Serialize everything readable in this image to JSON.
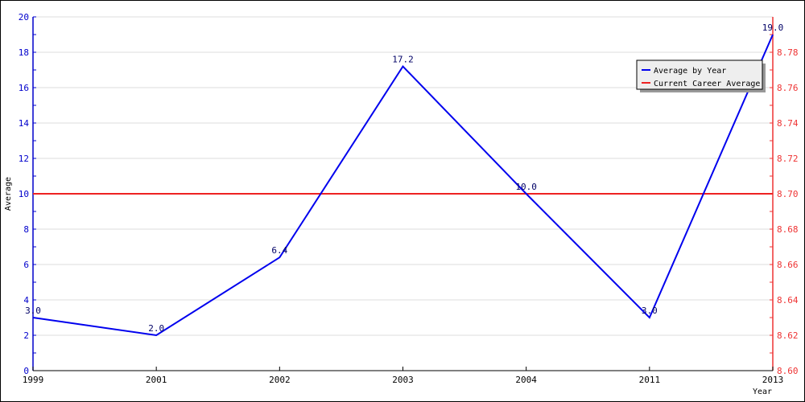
{
  "chart_data": {
    "type": "line",
    "title": "",
    "xlabel": "Year",
    "ylabel": "Average",
    "categories": [
      "1999",
      "2001",
      "2002",
      "2003",
      "2004",
      "2011",
      "2013"
    ],
    "series": [
      {
        "name": "Average by Year",
        "color": "#0000ee",
        "axis": "left",
        "values": [
          3.0,
          2.0,
          6.4,
          17.2,
          10.0,
          3.0,
          19.0
        ],
        "labels": [
          "3.0",
          "2.0",
          "6.4",
          "17.2",
          "10.0",
          "3.0",
          "19.0"
        ]
      },
      {
        "name": "Current Career Average",
        "color": "#ee2222",
        "axis": "right",
        "values": [
          8.7,
          8.7,
          8.7,
          8.7,
          8.7,
          8.7,
          8.7
        ]
      }
    ],
    "ylim": [
      0,
      20
    ],
    "yticks": [
      "0",
      "2",
      "4",
      "6",
      "8",
      "10",
      "12",
      "14",
      "16",
      "18",
      "20"
    ],
    "y2lim": [
      8.6,
      8.8
    ],
    "y2ticks": [
      "8.60",
      "8.62",
      "8.64",
      "8.66",
      "8.68",
      "8.70",
      "8.72",
      "8.74",
      "8.76",
      "8.78"
    ],
    "grid": true,
    "legend": "top-right",
    "colors": {
      "left_axis": "#0000cc",
      "right_axis": "#ee3333",
      "grid": "#dddddd"
    }
  }
}
